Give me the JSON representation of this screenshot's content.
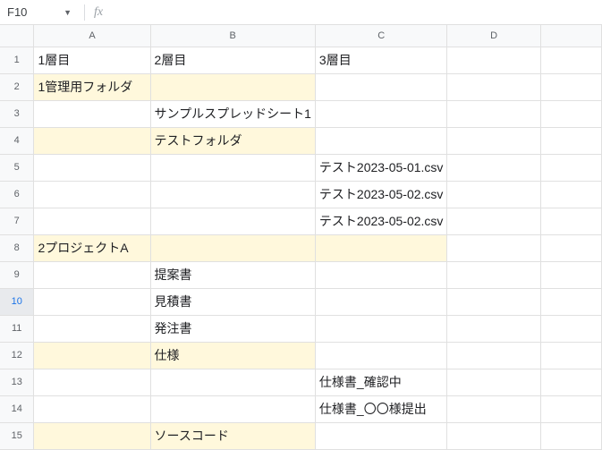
{
  "namebox": {
    "cell_ref": "F10"
  },
  "columns": [
    "A",
    "B",
    "C",
    "D",
    ""
  ],
  "row_count": 15,
  "selected_row": 10,
  "highlighted_cells": [
    "A2",
    "B2",
    "A4",
    "B4",
    "A8",
    "B8",
    "C8",
    "A12",
    "B12",
    "A15",
    "B15"
  ],
  "cells": {
    "A1": "1層目",
    "B1": "2層目",
    "C1": "3層目",
    "A2": "1管理用フォルダ",
    "B3": "サンプルスプレッドシート1",
    "B4": "テストフォルダ",
    "C5": "テスト2023-05-01.csv",
    "C6": "テスト2023-05-02.csv",
    "C7": "テスト2023-05-02.csv",
    "A8": "2プロジェクトA",
    "B9": "提案書",
    "B10": "見積書",
    "B11": "発注書",
    "B12": "仕様",
    "C13": "仕様書_確認中",
    "C14": "仕様書_〇〇様提出",
    "B15": "ソースコード"
  }
}
